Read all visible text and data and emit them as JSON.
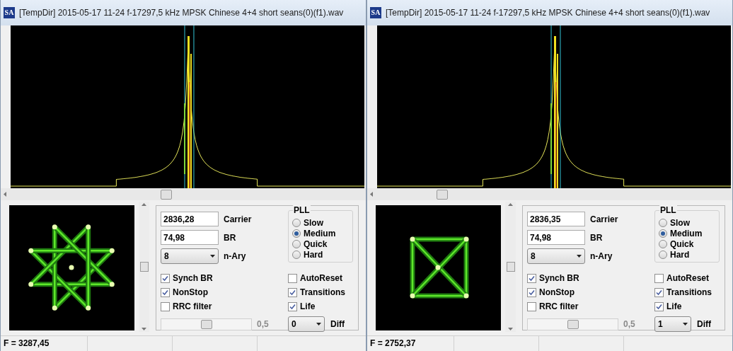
{
  "windows": [
    {
      "logo": "SA",
      "title": "[TempDir] 2015-05-17 11-24 f-17297,5 kHz MPSK Chinese 4+4 short seans(0)(f1).wav",
      "carrier": {
        "value": "2836,28",
        "label": "Carrier"
      },
      "br": {
        "value": "74,98",
        "label": "BR"
      },
      "n_ary": {
        "value": "8",
        "label": "n-Ary"
      },
      "pll": {
        "title": "PLL",
        "options": [
          {
            "label": "Slow",
            "selected": false
          },
          {
            "label": "Medium",
            "selected": true
          },
          {
            "label": "Quick",
            "selected": false
          },
          {
            "label": "Hard",
            "selected": false
          }
        ]
      },
      "checkboxes": [
        {
          "label": "Synch BR",
          "checked": true
        },
        {
          "label": "AutoReset",
          "checked": false
        },
        {
          "label": "NonStop",
          "checked": true
        },
        {
          "label": "Transitions",
          "checked": true
        },
        {
          "label": "RRC filter",
          "checked": false
        },
        {
          "label": "Life",
          "checked": true
        }
      ],
      "slider": {
        "level": 0.5,
        "reading": "0,5"
      },
      "diff": {
        "value": "0",
        "label": "Diff"
      },
      "status": "F = 3287,45"
    },
    {
      "logo": "SA",
      "title": "[TempDir] 2015-05-17 11-24 f-17297,5 kHz MPSK Chinese 4+4 short seans(0)(f1).wav",
      "carrier": {
        "value": "2836,35",
        "label": "Carrier"
      },
      "br": {
        "value": "74,98",
        "label": "BR"
      },
      "n_ary": {
        "value": "8",
        "label": "n-Ary"
      },
      "pll": {
        "title": "PLL",
        "options": [
          {
            "label": "Slow",
            "selected": false
          },
          {
            "label": "Medium",
            "selected": true
          },
          {
            "label": "Quick",
            "selected": false
          },
          {
            "label": "Hard",
            "selected": false
          }
        ]
      },
      "checkboxes": [
        {
          "label": "Synch BR",
          "checked": true
        },
        {
          "label": "AutoReset",
          "checked": false
        },
        {
          "label": "NonStop",
          "checked": true
        },
        {
          "label": "Transitions",
          "checked": true
        },
        {
          "label": "RRC filter",
          "checked": false
        },
        {
          "label": "Life",
          "checked": true
        }
      ],
      "slider": {
        "level": 0.5,
        "reading": "0,5"
      },
      "diff": {
        "value": "1",
        "label": "Diff"
      },
      "status": "F = 2752,37"
    }
  ]
}
